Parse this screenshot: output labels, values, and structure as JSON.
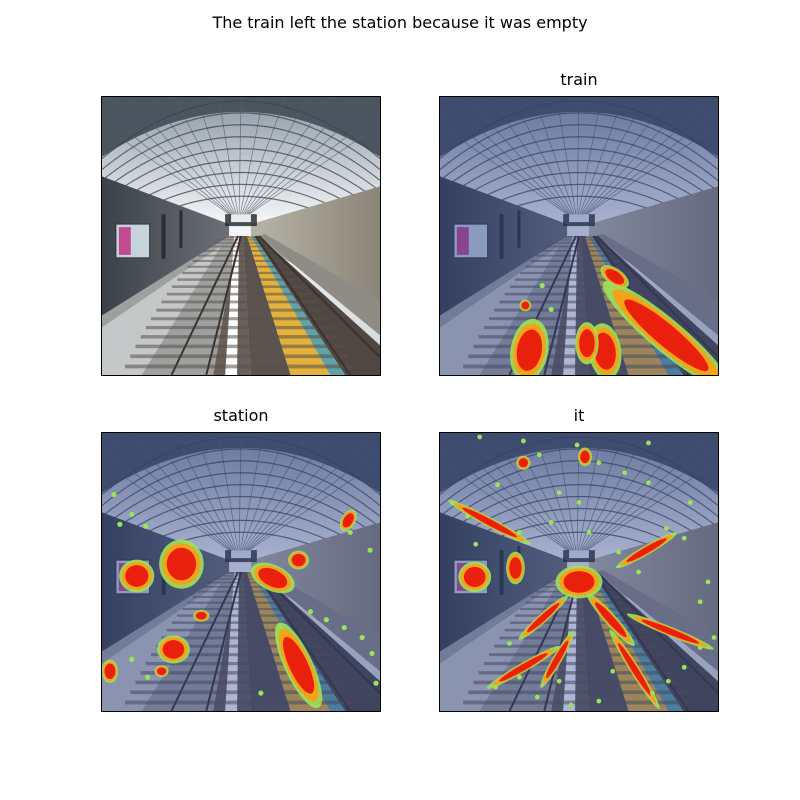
{
  "figure": {
    "title": "The train left the station because it was empty"
  },
  "panels": [
    {
      "id": "original",
      "title": "",
      "heatmap": false
    },
    {
      "id": "train",
      "title": "train",
      "heatmap": true
    },
    {
      "id": "station",
      "title": "station",
      "heatmap": true
    },
    {
      "id": "it",
      "title": "it",
      "heatmap": true
    }
  ],
  "colors": {
    "heat_hot": "#e8200c",
    "heat_warm": "#f5a21b",
    "heat_edge": "#9be35a",
    "tint": "#2b3f8c"
  }
}
